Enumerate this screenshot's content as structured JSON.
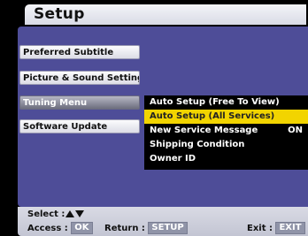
{
  "header": {
    "title": "Setup"
  },
  "menu": {
    "left_items": [
      {
        "label": "Preferred Subtitle"
      },
      {
        "label": "Picture & Sound Setting"
      },
      {
        "label": "Tuning Menu",
        "selected": true
      },
      {
        "label": "Software Update"
      }
    ],
    "submenu": [
      {
        "label": "Auto Setup (Free To View)",
        "value": ""
      },
      {
        "label": "Auto Setup (All Services)",
        "value": "",
        "highlighted": true
      },
      {
        "label": "New Service Message",
        "value": "ON"
      },
      {
        "label": "Shipping Condition",
        "value": ""
      },
      {
        "label": "Owner ID",
        "value": ""
      }
    ]
  },
  "footer": {
    "select_label": "Select :",
    "access_label": "Access :",
    "access_key": "OK",
    "return_label": "Return :",
    "return_key": "SETUP",
    "exit_label": "Exit :",
    "exit_key": "EXIT"
  },
  "colors": {
    "panel": "#4e4d98",
    "highlight": "#f2d400",
    "footer": "#cfd1dc"
  }
}
